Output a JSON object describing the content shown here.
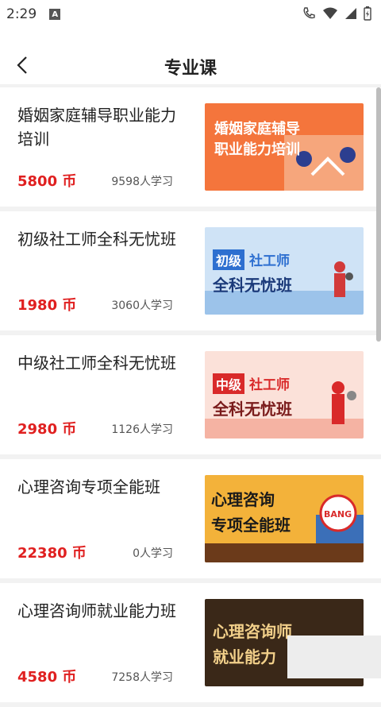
{
  "status_bar": {
    "time": "2:29",
    "a_icon_label": "A"
  },
  "header": {
    "title": "专业课"
  },
  "courses": [
    {
      "title": "婚姻家庭辅导职业能力培训",
      "price": "5800 币",
      "learners": "9598人学习",
      "thumb": {
        "line1": "婚姻家庭辅导",
        "line2": "职业能力培训",
        "bg": "#f4753c"
      }
    },
    {
      "title": "初级社工师全科无忧班",
      "price": "1980 币",
      "learners": "3060人学习",
      "thumb": {
        "tag": "初级",
        "line1": "社工师",
        "line2": "全科无忧班",
        "bg": "#cfe3f6",
        "tag_color": "#2d6fd0"
      }
    },
    {
      "title": "中级社工师全科无忧班",
      "price": "2980 币",
      "learners": "1126人学习",
      "thumb": {
        "tag": "中级",
        "line1": "社工师",
        "line2": "全科无忧班",
        "bg": "#fbe1d9",
        "tag_color": "#d92a2a"
      }
    },
    {
      "title": "心理咨询专项全能班",
      "price": "22380 币",
      "learners": "0人学习",
      "thumb": {
        "line1": "心理咨询",
        "line2": "专项全能班",
        "badge": "BANG",
        "bg": "#f3b23a"
      }
    },
    {
      "title": "心理咨询师就业能力班",
      "price": "4580 币",
      "learners": "7258人学习",
      "thumb": {
        "line1": "心理咨询师",
        "line2": "就业能力",
        "bg": "#3a2818"
      }
    }
  ]
}
